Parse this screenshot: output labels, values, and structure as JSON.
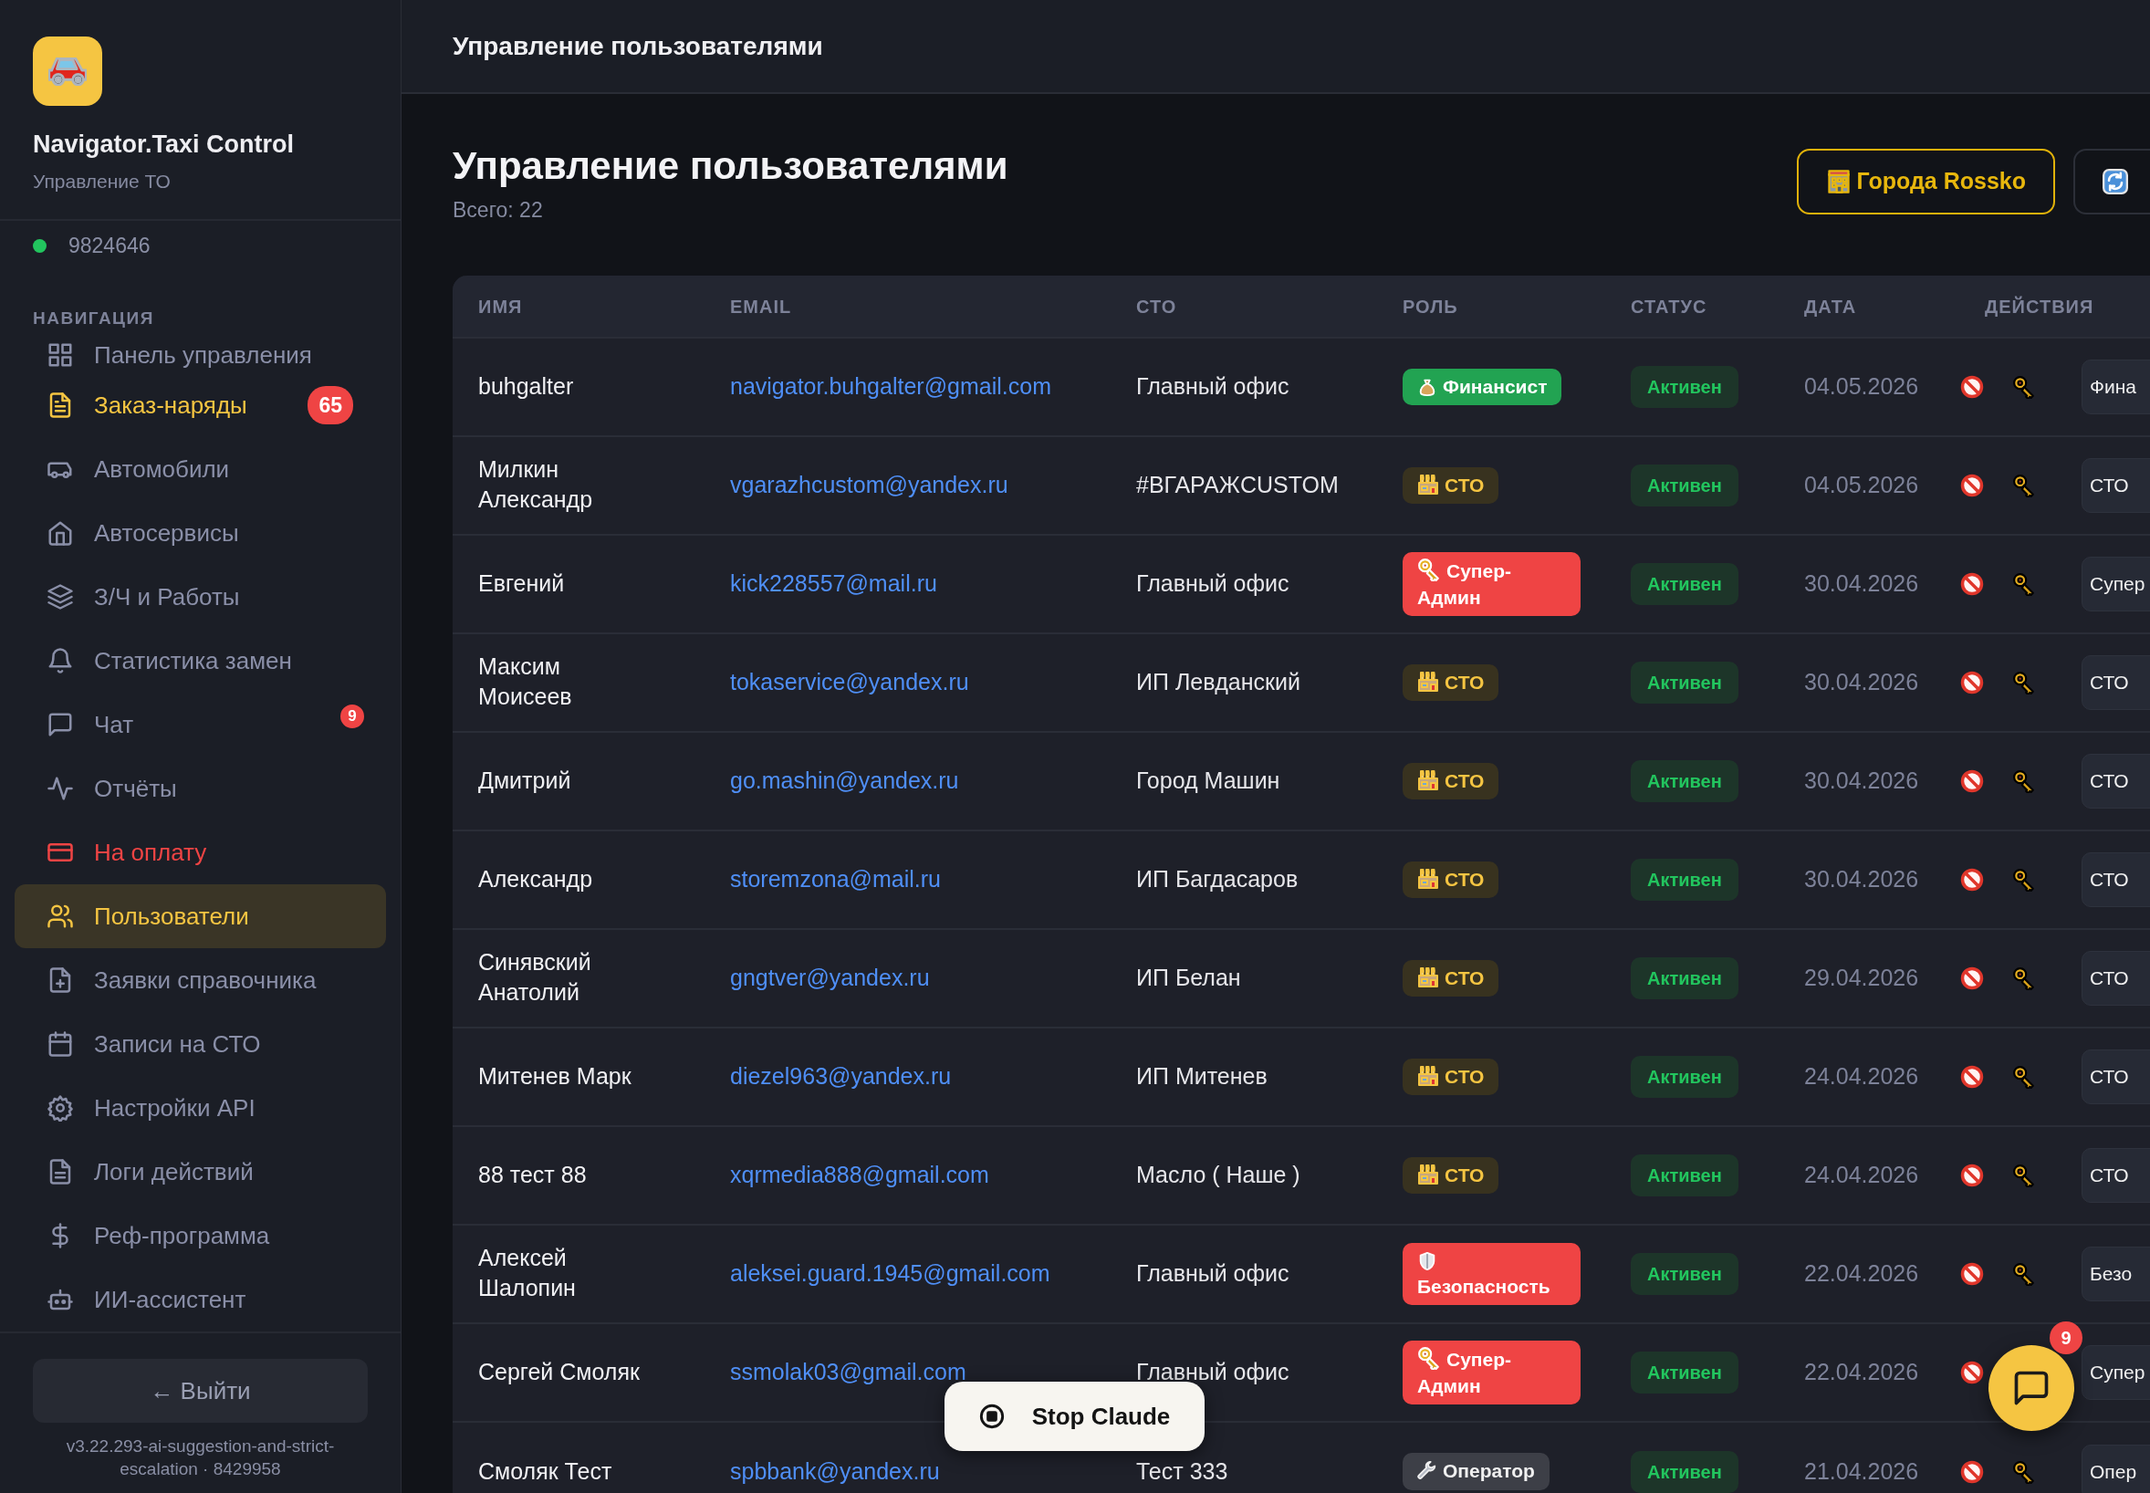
{
  "sidebar": {
    "app_name": "Navigator.Taxi Control",
    "app_subtitle": "Управление ТО",
    "user": {
      "id": "9824646",
      "online": true
    },
    "nav_heading": "НАВИГАЦИЯ",
    "items": [
      {
        "label": "Панель управления",
        "kind": "normal",
        "selected": false
      },
      {
        "label": "Заказ-наряды",
        "kind": "accent",
        "selected": false,
        "badge": "65",
        "badge_large": true
      },
      {
        "label": "Автомобили",
        "kind": "normal",
        "selected": false
      },
      {
        "label": "Автосервисы",
        "kind": "normal",
        "selected": false
      },
      {
        "label": "З/Ч и Работы",
        "kind": "normal",
        "selected": false
      },
      {
        "label": "Статистика замен",
        "kind": "normal",
        "selected": false
      },
      {
        "label": "Чат",
        "kind": "normal",
        "selected": false,
        "badge": "9",
        "badge_large": false
      },
      {
        "label": "Отчёты",
        "kind": "normal",
        "selected": false
      },
      {
        "label": "На оплату",
        "kind": "danger",
        "selected": false
      },
      {
        "label": "Пользователи",
        "kind": "normal",
        "selected": true
      },
      {
        "label": "Заявки справочника",
        "kind": "normal",
        "selected": false
      },
      {
        "label": "Записи на СТО",
        "kind": "normal",
        "selected": false
      },
      {
        "label": "Настройки API",
        "kind": "normal",
        "selected": false
      },
      {
        "label": "Логи действий",
        "kind": "normal",
        "selected": false
      },
      {
        "label": "Реф-программа",
        "kind": "normal",
        "selected": false
      },
      {
        "label": "ИИ-ассистент",
        "kind": "normal",
        "selected": false
      }
    ],
    "logout": "← Выйти",
    "version": "v3.22.293-ai-suggestion-and-strict-escalation · 8429958"
  },
  "topbar": {
    "title": "Управление пользователями"
  },
  "page": {
    "title": "Управление пользователями",
    "total": "Всего: 22",
    "buttons": [
      {
        "kind": "cities",
        "label": "Города Rossko"
      },
      {
        "kind": "refresh"
      }
    ]
  },
  "table": {
    "columns": [
      "ИМЯ",
      "EMAIL",
      "СТО",
      "РОЛЬ",
      "СТАТУС",
      "ДАТА",
      "ДЕЙСТВИЯ"
    ],
    "rows": [
      {
        "name": "buhgalter",
        "email": "navigator.buhgalter@gmail.com",
        "sto": "Главный офис",
        "role": {
          "label": "Финансист",
          "kind": "finance"
        },
        "status": "Активен",
        "date": "04.05.2026",
        "role_select": "Фина"
      },
      {
        "name": "Милкин Александр",
        "email": "vgarazhcustom@yandex.ru",
        "sto": "#ВГАРАЖCUSTOM",
        "role": {
          "label": "СТО",
          "kind": "sto"
        },
        "status": "Активен",
        "date": "04.05.2026",
        "role_select": "СТО"
      },
      {
        "name": "Евгений",
        "email": "kick228557@mail.ru",
        "sto": "Главный офис",
        "role": {
          "label": "Супер-Админ",
          "kind": "superadmin"
        },
        "status": "Активен",
        "date": "30.04.2026",
        "role_select": "Супер"
      },
      {
        "name": "Максим Моисеев",
        "email": "tokaservice@yandex.ru",
        "sto": "ИП Левданский",
        "role": {
          "label": "СТО",
          "kind": "sto"
        },
        "status": "Активен",
        "date": "30.04.2026",
        "role_select": "СТО"
      },
      {
        "name": "Дмитрий",
        "email": "go.mashin@yandex.ru",
        "sto": "Город Машин",
        "role": {
          "label": "СТО",
          "kind": "sto"
        },
        "status": "Активен",
        "date": "30.04.2026",
        "role_select": "СТО"
      },
      {
        "name": "Александр",
        "email": "storemzona@mail.ru",
        "sto": "ИП Багдасаров",
        "role": {
          "label": "СТО",
          "kind": "sto"
        },
        "status": "Активен",
        "date": "30.04.2026",
        "role_select": "СТО"
      },
      {
        "name": "Синявский Анатолий",
        "email": "gngtver@yandex.ru",
        "sto": "ИП Белан",
        "role": {
          "label": "СТО",
          "kind": "sto"
        },
        "status": "Активен",
        "date": "29.04.2026",
        "role_select": "СТО"
      },
      {
        "name": "Митенев Марк",
        "email": "diezel963@yandex.ru",
        "sto": "ИП Митенев",
        "role": {
          "label": "СТО",
          "kind": "sto"
        },
        "status": "Активен",
        "date": "24.04.2026",
        "role_select": "СТО"
      },
      {
        "name": "88 тест 88",
        "email": "xqrmedia888@gmail.com",
        "sto": "Масло ( Наше )",
        "role": {
          "label": "СТО",
          "kind": "sto"
        },
        "status": "Активен",
        "date": "24.04.2026",
        "role_select": "СТО"
      },
      {
        "name": "Алексей Шалопин",
        "email": "aleksei.guard.1945@gmail.com",
        "sto": "Главный офис",
        "role": {
          "label": "Безопасность",
          "kind": "security"
        },
        "status": "Активен",
        "date": "22.04.2026",
        "role_select": "Безо"
      },
      {
        "name": "Сергей Смоляк",
        "email": "ssmolak03@gmail.com",
        "sto": "Главный офис",
        "role": {
          "label": "Супер-Админ",
          "kind": "superadmin"
        },
        "status": "Активен",
        "date": "22.04.2026",
        "role_select": "Супер"
      },
      {
        "name": "Смоляк Тест",
        "email": "spbbank@yandex.ru",
        "sto": "Тест 333",
        "role": {
          "label": "Оператор",
          "kind": "operator"
        },
        "status": "Активен",
        "date": "21.04.2026",
        "role_select": "Опер"
      }
    ]
  },
  "overlay": {
    "stop_button": "Stop Claude"
  },
  "chat_fab": {
    "badge": "9"
  }
}
